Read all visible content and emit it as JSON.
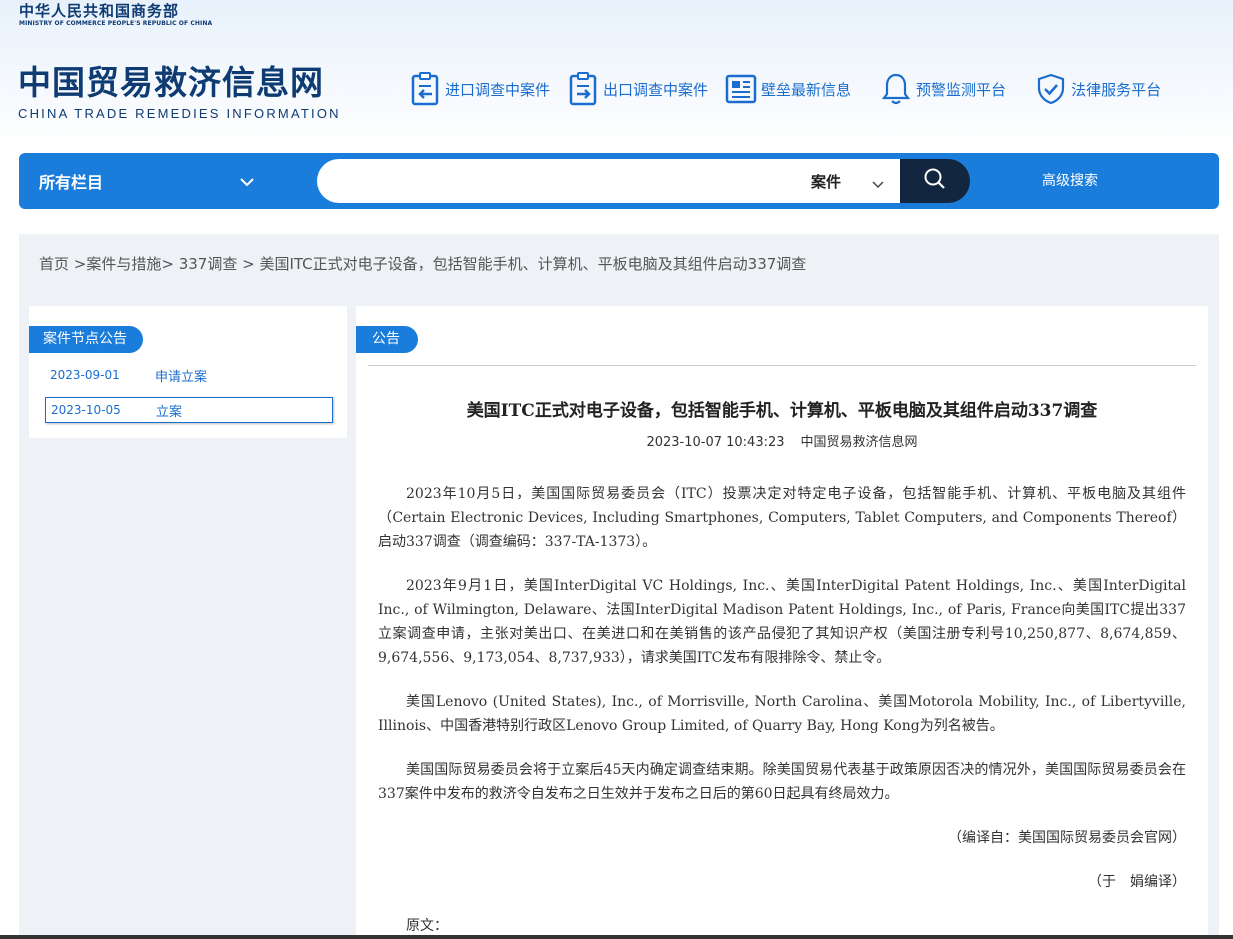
{
  "header": {
    "gov_cn": "中华人民共和国商务部",
    "gov_en": "MINISTRY OF COMMERCE PEOPLE'S REPUBLIC OF CHINA",
    "logo_cn": "中国贸易救济信息网",
    "logo_en": "CHINA TRADE REMEDIES INFORMATION",
    "nav": [
      {
        "label": "进口调查中案件",
        "icon": "import-case-icon"
      },
      {
        "label": "出口调查中案件",
        "icon": "export-case-icon"
      },
      {
        "label": "壁垒最新信息",
        "icon": "news-icon"
      },
      {
        "label": "预警监测平台",
        "icon": "bell-icon"
      },
      {
        "label": "法律服务平台",
        "icon": "shield-check-icon"
      }
    ]
  },
  "search": {
    "category": "所有栏目",
    "type": "案件",
    "query": "",
    "advanced": "高级搜索"
  },
  "breadcrumb": {
    "home": "首页",
    "sep1": " >",
    "level1": "案件与措施",
    "sep2": "> ",
    "level2": "337调查",
    "sep3": " > ",
    "current": "美国ITC正式对电子设备，包括智能手机、计算机、平板电脑及其组件启动337调查"
  },
  "sidebar": {
    "title": "案件节点公告",
    "nodes": [
      {
        "date": "2023-09-01",
        "label": "申请立案"
      },
      {
        "date": "2023-10-05",
        "label": "立案"
      }
    ]
  },
  "article": {
    "tab": "公告",
    "title": "美国ITC正式对电子设备，包括智能手机、计算机、平板电脑及其组件启动337调查",
    "datetime": "2023-10-07 10:43:23",
    "source": "中国贸易救济信息网",
    "paragraphs": [
      "2023年10月5日，美国国际贸易委员会（ITC）投票决定对特定电子设备，包括智能手机、计算机、平板电脑及其组件（Certain Electronic Devices, Including Smartphones, Computers, Tablet Computers, and Components Thereof）启动337调查（调查编码：337-TA-1373）。",
      "2023年9月1日，美国InterDigital VC Holdings, Inc.、美国InterDigital Patent Holdings, Inc.、美国InterDigital Inc., of Wilmington, Delaware、法国InterDigital Madison Patent Holdings, Inc., of Paris, France向美国ITC提出337立案调查申请，主张对美出口、在美进口和在美销售的该产品侵犯了其知识产权（美国注册专利号10,250,877、8,674,859、9,674,556、9,173,054、8,737,933），请求美国ITC发布有限排除令、禁止令。",
      "美国Lenovo (United States), Inc., of Morrisville, North Carolina、美国Motorola Mobility, Inc., of Libertyville, Illinois、中国香港特别行政区Lenovo Group Limited, of Quarry Bay, Hong Kong为列名被告。",
      "美国国际贸易委员会将于立案后45天内确定调查结束期。除美国贸易代表基于政策原因否决的情况外，美国国际贸易委员会在337案件中发布的救济令自发布之日生效并于发布之日后的第60日起具有终局效力。"
    ],
    "compiled_from": "（编译自：美国国际贸易委员会官网）",
    "editor": "（于　娟编译）",
    "original_label": "原文："
  }
}
